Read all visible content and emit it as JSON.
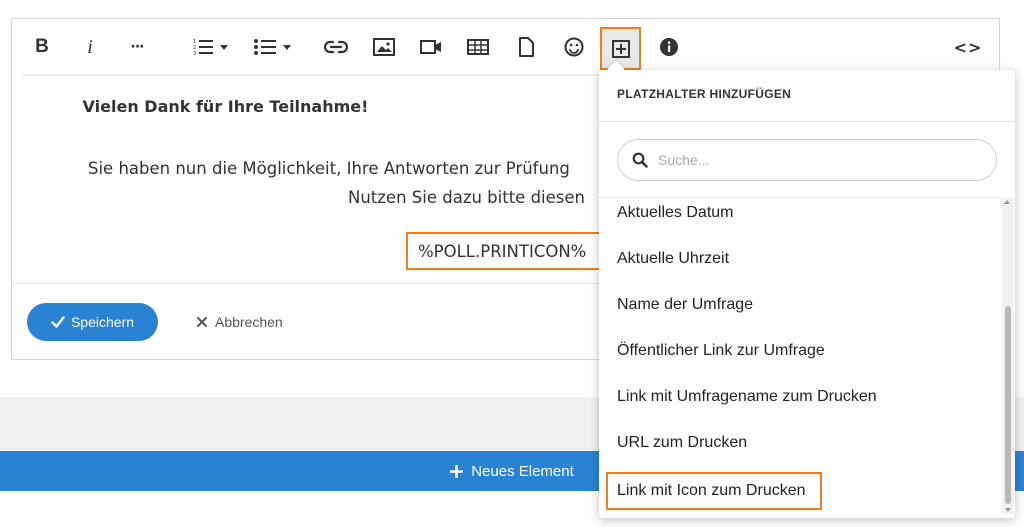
{
  "toolbar": {
    "bold_icon": "bold-icon",
    "italic_icon": "italic-icon",
    "more_icon": "more-icon",
    "ordered_list_icon": "ordered-list-icon",
    "bullet_list_icon": "bullet-list-icon",
    "link_icon": "link-icon",
    "image_icon": "image-icon",
    "video_icon": "video-icon",
    "table_icon": "table-icon",
    "file_icon": "file-icon",
    "emoji_icon": "emoji-icon",
    "add_placeholder_icon": "plus-square-icon",
    "info_icon": "info-icon",
    "code_icon": "code-view-icon",
    "bold_label": "B",
    "italic_label": "i",
    "more_label": "···",
    "code_label": "<>"
  },
  "content": {
    "thanks_text": "Vielen Dank für Ihre Teilnahme!",
    "paragraph_line1": "Sie haben nun die Möglichkeit, Ihre Antworten zur Prüfung",
    "paragraph_line2": "Nutzen Sie dazu bitte diesen",
    "placeholder_token": "%POLL.PRINTICON%"
  },
  "actions": {
    "save_label": "Speichern",
    "cancel_label": "Abbrechen"
  },
  "new_element": {
    "label": "Neues Element"
  },
  "dropdown": {
    "title": "PLATZHALTER HINZUFÜGEN",
    "search_placeholder": "Suche...",
    "items": [
      {
        "label": "Aktuelles Datum"
      },
      {
        "label": "Aktuelle Uhrzeit"
      },
      {
        "label": "Name der Umfrage"
      },
      {
        "label": "Öffentlicher Link zur Umfrage"
      },
      {
        "label": "Link mit Umfragename zum Drucken"
      },
      {
        "label": "URL zum Drucken"
      },
      {
        "label": "Link mit Icon zum Drucken"
      }
    ]
  },
  "colors": {
    "accent_blue": "#2a82d3",
    "highlight_orange": "#ef7d22",
    "text_dark": "#333333"
  }
}
